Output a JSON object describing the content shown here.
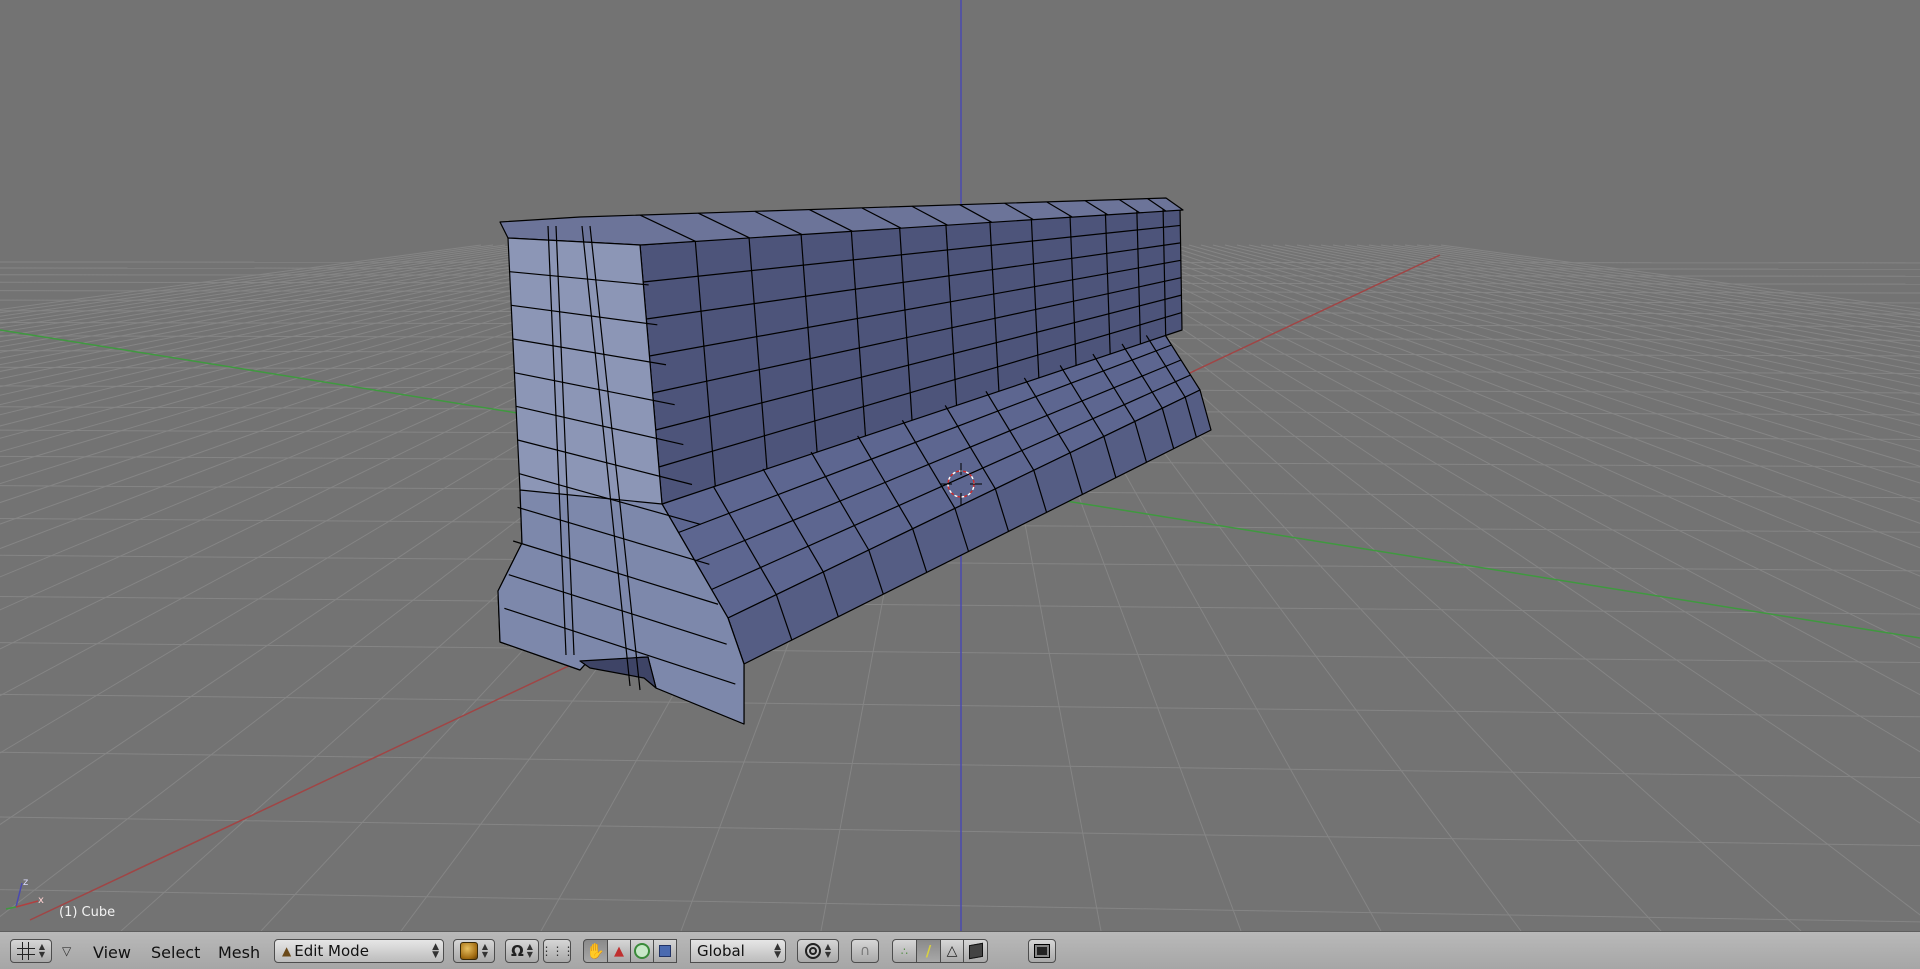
{
  "viewport": {
    "object_label": "(1) Cube",
    "axis_widget": {
      "x": "x",
      "y": "y",
      "z": "z"
    }
  },
  "header": {
    "editor_type_icon": "3d-view-grid-icon",
    "menus": {
      "view": "View",
      "select": "Select",
      "mesh": "Mesh"
    },
    "mode_select": {
      "value": "Edit Mode",
      "icon": "mode-triangle-icon"
    },
    "viewport_shading_icon": "solid-shading-icon",
    "pivot_icon": "pivot-icon",
    "transform_orientation": {
      "value": "Global"
    },
    "proportional_edit_icon": "proportional-edit-icon",
    "snap_icon": "magnet-icon",
    "select_mode_icons": [
      "vertex-select-icon",
      "edge-select-icon",
      "face-select-icon"
    ],
    "occlude_icon": "occlude-geometry-icon",
    "render_icon": "render-image-icon"
  },
  "colors": {
    "background": "#737373",
    "grid": "#808080",
    "axis_x": "#a04545",
    "axis_y": "#3f993f",
    "axis_z": "#4a4ab0",
    "mesh_face": "#5a6288",
    "mesh_edge": "#000000"
  }
}
